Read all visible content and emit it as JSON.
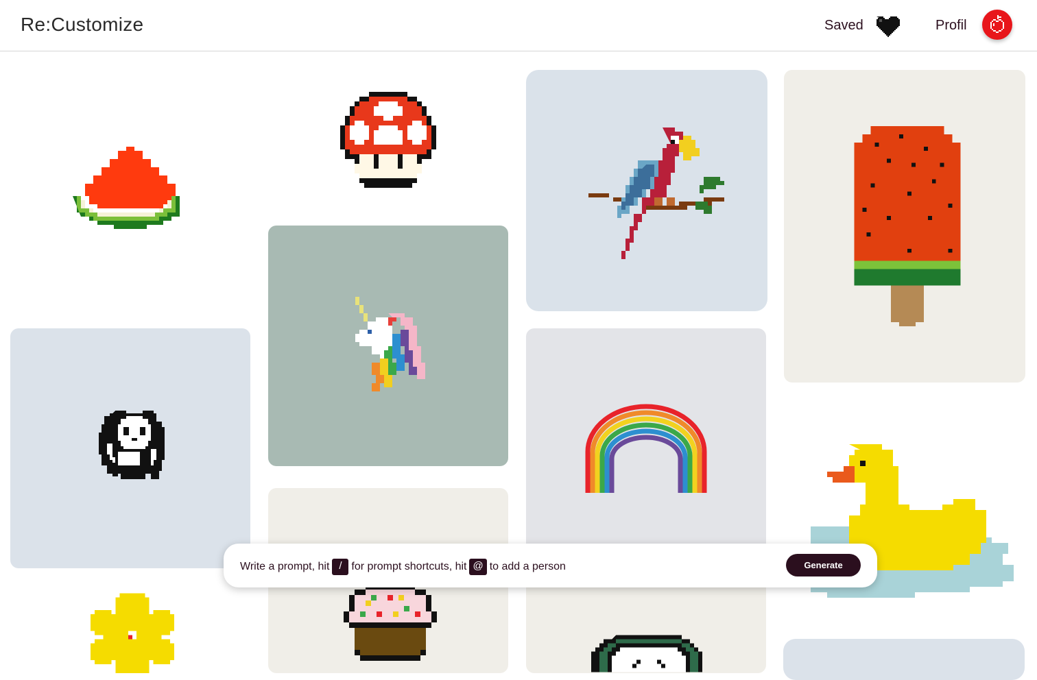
{
  "header": {
    "brand": "Re:Customize",
    "saved_label": "Saved",
    "profile_label": "Profil",
    "heart_icon": "pixel-heart-icon",
    "avatar_icon": "pixel-apple-icon"
  },
  "gallery": {
    "items": [
      {
        "name": "watermelon",
        "bg": "#ffffff"
      },
      {
        "name": "mushroom",
        "bg": "#ffffff"
      },
      {
        "name": "parrot",
        "bg": "#dae2ea"
      },
      {
        "name": "watermelon-popsicle",
        "bg": "#f0eee8"
      },
      {
        "name": "unicorn",
        "bg": "#a8bab3"
      },
      {
        "name": "panda",
        "bg": "#dbe2ea"
      },
      {
        "name": "rainbow",
        "bg": "#e3e4e8"
      },
      {
        "name": "duck",
        "bg": "#ffffff"
      },
      {
        "name": "flower",
        "bg": "#ffffff"
      },
      {
        "name": "cupcake",
        "bg": "#f0eee8"
      },
      {
        "name": "clock",
        "bg": "#f0eee8"
      },
      {
        "name": "blank",
        "bg": "#dbe2ea"
      }
    ]
  },
  "prompt": {
    "part1": "Write a prompt, hit",
    "key1": "/",
    "part2": "for prompt shortcuts, hit",
    "key2": "@",
    "part3": "to add a person",
    "generate_label": "Generate"
  },
  "colors": {
    "accent": "#2b0f1e",
    "avatar": "#e8161b"
  }
}
